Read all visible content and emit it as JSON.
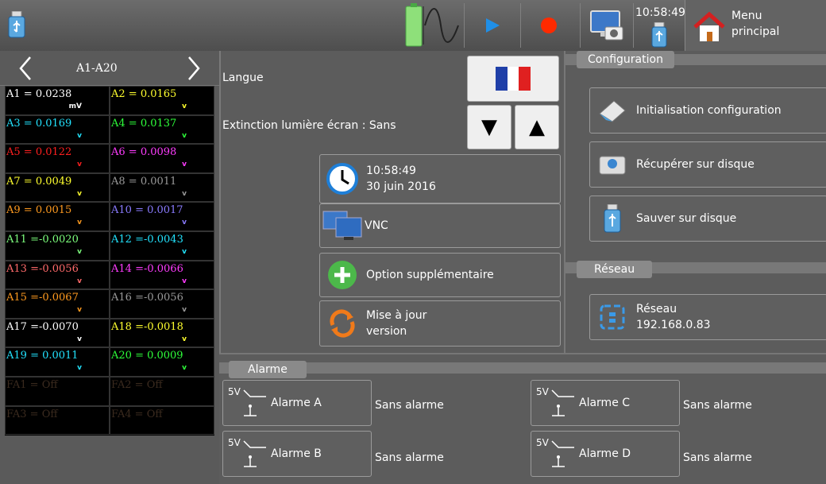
{
  "topbar": {
    "clock": "10:58:49",
    "menu_line1": "Menu",
    "menu_line2": "principal",
    "colors": {
      "play": "#1f8fe8",
      "record": "#ff2a00",
      "battery": "#7fd160"
    }
  },
  "channels": {
    "title": "A1-A20",
    "items": [
      {
        "label": "A1 = 0.0238",
        "unit": "mV",
        "color": "#ffffff"
      },
      {
        "label": "A2 = 0.0165",
        "unit": "v",
        "color": "#ffff2e"
      },
      {
        "label": "A3 = 0.0169",
        "unit": "v",
        "color": "#22e3ff"
      },
      {
        "label": "A4 = 0.0137",
        "unit": "v",
        "color": "#2eff3a"
      },
      {
        "label": "A5 = 0.0122",
        "unit": "v",
        "color": "#ff1f1f"
      },
      {
        "label": "A6 = 0.0098",
        "unit": "v",
        "color": "#ff3cff"
      },
      {
        "label": "A7 = 0.0049",
        "unit": "v",
        "color": "#ffff2e"
      },
      {
        "label": "A8 = 0.0011",
        "unit": "v",
        "color": "#9a9a9a"
      },
      {
        "label": "A9 = 0.0015",
        "unit": "v",
        "color": "#ff9a1f"
      },
      {
        "label": "A10 = 0.0017",
        "unit": "v",
        "color": "#8a7bff"
      },
      {
        "label": "A11 =-0.0020",
        "unit": "v",
        "color": "#7dff7d"
      },
      {
        "label": "A12 =-0.0043",
        "unit": "v",
        "color": "#22e3ff"
      },
      {
        "label": "A13 =-0.0056",
        "unit": "v",
        "color": "#ff6a6a"
      },
      {
        "label": "A14 =-0.0066",
        "unit": "v",
        "color": "#ff3cff"
      },
      {
        "label": "A15 =-0.0067",
        "unit": "v",
        "color": "#ff9a1f"
      },
      {
        "label": "A16 =-0.0056",
        "unit": "v",
        "color": "#9a9a9a"
      },
      {
        "label": "A17 =-0.0070",
        "unit": "v",
        "color": "#ffffff"
      },
      {
        "label": "A18 =-0.0018",
        "unit": "v",
        "color": "#ffff2e"
      },
      {
        "label": "A19 = 0.0011",
        "unit": "v",
        "color": "#22e3ff"
      },
      {
        "label": "A20 = 0.0009",
        "unit": "v",
        "color": "#2eff3a"
      },
      {
        "label": "FA1 = Off",
        "unit": "",
        "color": "#3a2a1e"
      },
      {
        "label": "FA2 = Off",
        "unit": "",
        "color": "#3a2a1e"
      },
      {
        "label": "FA3 = Off",
        "unit": "",
        "color": "#3a2a1e"
      },
      {
        "label": "FA4 = Off",
        "unit": "",
        "color": "#3a2a1e"
      }
    ]
  },
  "settings": {
    "langue_label": "Langue",
    "extinction_label": "Extinction lumière écran : Sans",
    "datetime_time": "10:58:49",
    "datetime_date": "30 juin 2016",
    "vnc_label": "VNC",
    "option_label": "Option supplémentaire",
    "update_line1": "Mise à jour",
    "update_line2": "version"
  },
  "configuration": {
    "title": "Configuration",
    "init_label": "Initialisation configuration",
    "recover_label": "Récupérer sur disque",
    "save_label": "Sauver sur disque"
  },
  "network": {
    "title": "Réseau",
    "label": "Réseau",
    "ip": "192.168.0.83"
  },
  "alarms": {
    "title": "Alarme",
    "symbol_text": "5V",
    "items": [
      {
        "name": "Alarme  A",
        "status": "Sans alarme"
      },
      {
        "name": "Alarme  B",
        "status": "Sans alarme"
      },
      {
        "name": "Alarme  C",
        "status": "Sans alarme"
      },
      {
        "name": "Alarme  D",
        "status": "Sans alarme"
      }
    ]
  }
}
